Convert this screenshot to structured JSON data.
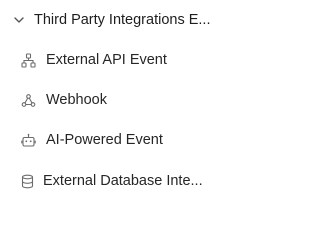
{
  "group": {
    "label": "Third Party Integrations E...",
    "expanded": true,
    "icon": "chevron-down-icon"
  },
  "items": [
    {
      "label": "External API Event",
      "icon": "network-nodes-icon"
    },
    {
      "label": "Webhook",
      "icon": "webhook-icon"
    },
    {
      "label": "AI-Powered Event",
      "icon": "robot-icon"
    },
    {
      "label": "External Database Inte...",
      "icon": "database-icon"
    }
  ],
  "colors": {
    "text": "#1f1f1f",
    "icon": "#6b6b6b",
    "background": "#ffffff"
  }
}
